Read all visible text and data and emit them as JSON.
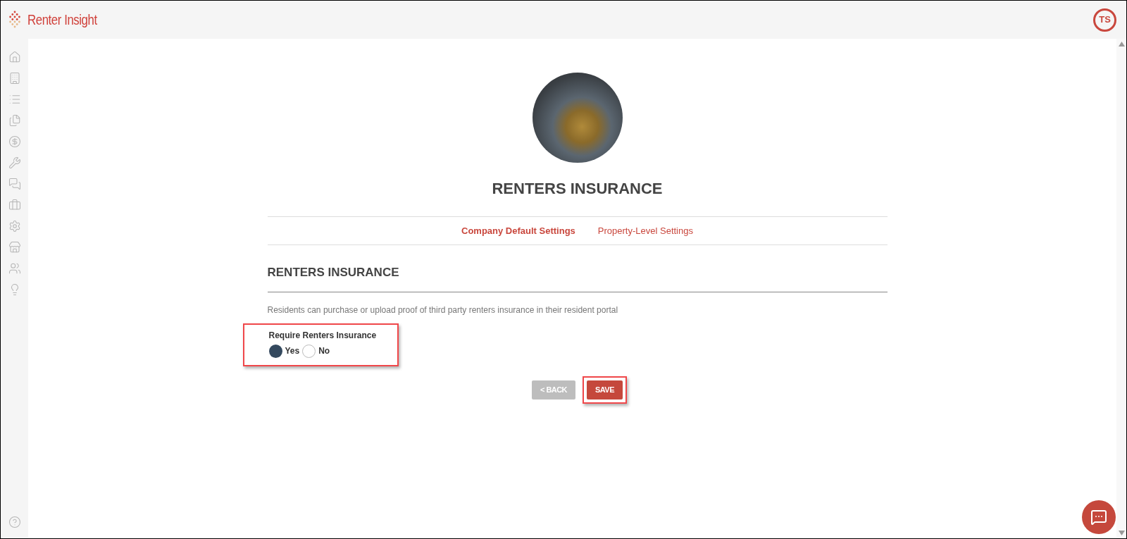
{
  "header": {
    "logo_text": "Renter Insight",
    "avatar_initials": "TS"
  },
  "page": {
    "title": "RENTERS INSURANCE",
    "tabs": [
      {
        "label": "Company Default Settings",
        "selected": true
      },
      {
        "label": "Property-Level Settings",
        "selected": false
      }
    ],
    "section": {
      "heading": "RENTERS INSURANCE",
      "description": "Residents can purchase or upload proof of third party renters insurance in their resident portal",
      "field": {
        "label": "Require Renters Insurance",
        "highlighted": true,
        "options": [
          {
            "label": "Yes",
            "selected": true
          },
          {
            "label": "No",
            "selected": false
          }
        ]
      }
    },
    "buttons": [
      {
        "label": "< BACK",
        "kind": "secondary",
        "highlighted": false
      },
      {
        "label": "SAVE",
        "kind": "primary",
        "highlighted": true
      }
    ]
  }
}
